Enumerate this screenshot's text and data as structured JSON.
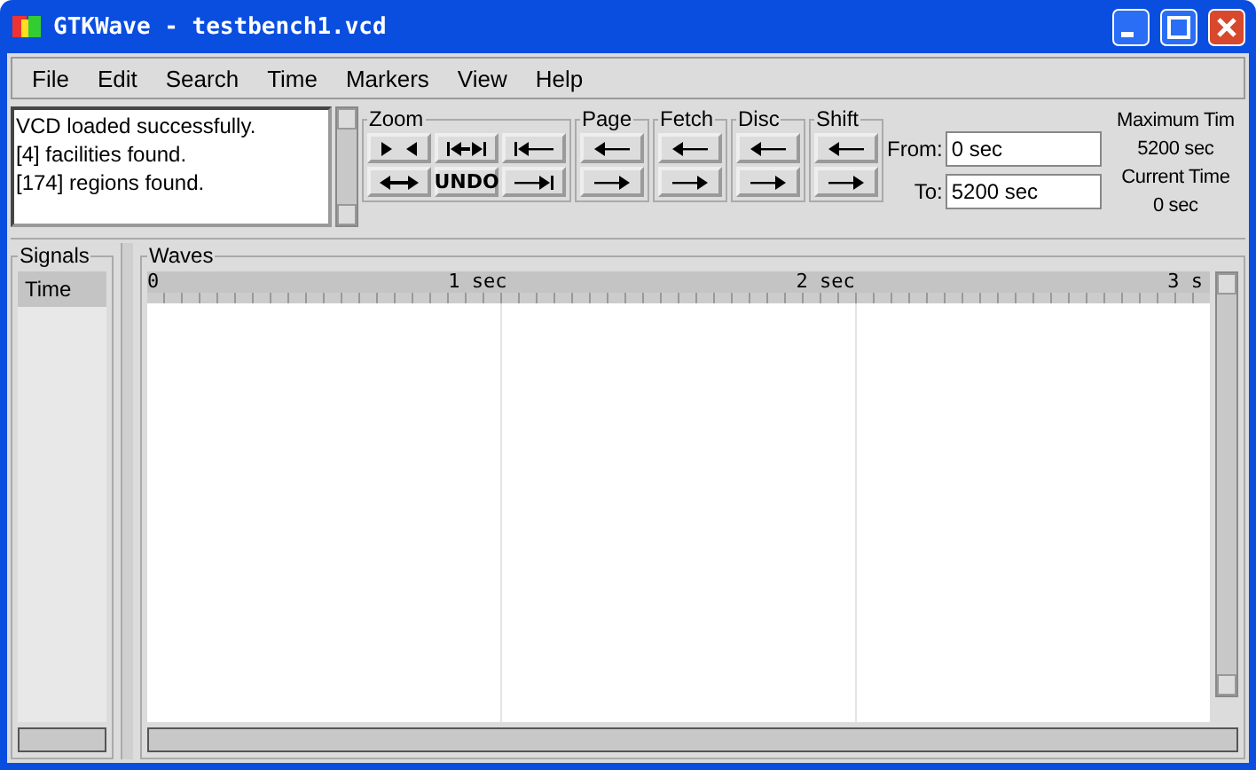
{
  "window": {
    "title": "GTKWave - testbench1.vcd"
  },
  "menu": [
    "File",
    "Edit",
    "Search",
    "Time",
    "Markers",
    "View",
    "Help"
  ],
  "log": [
    "VCD loaded successfully.",
    "[4] facilities found.",
    "[174] regions found."
  ],
  "groups": [
    {
      "title": "Zoom",
      "buttons": [
        {
          "kind": "in"
        },
        {
          "kind": "fit"
        },
        {
          "kind": "start"
        },
        {
          "kind": "out"
        },
        {
          "kind": "text",
          "label": "UNDO"
        },
        {
          "kind": "end"
        }
      ]
    },
    {
      "title": "Page",
      "buttons": [
        {
          "kind": "left"
        },
        {
          "kind": "right"
        }
      ]
    },
    {
      "title": "Fetch",
      "buttons": [
        {
          "kind": "left"
        },
        {
          "kind": "right"
        }
      ]
    },
    {
      "title": "Disc",
      "buttons": [
        {
          "kind": "left"
        },
        {
          "kind": "right"
        }
      ]
    },
    {
      "title": "Shift",
      "buttons": [
        {
          "kind": "left"
        },
        {
          "kind": "right"
        }
      ]
    }
  ],
  "range": {
    "from_label": "From:",
    "from": "0 sec",
    "to_label": "To:",
    "to": "5200 sec"
  },
  "times": [
    "Maximum Tim",
    "5200 sec",
    "Current Time",
    "0 sec"
  ],
  "signals": {
    "title": "Signals",
    "items": [
      "Time"
    ]
  },
  "waves": {
    "title": "Waves",
    "ruler": [
      "0",
      "1 sec",
      "2 sec",
      "3 s"
    ]
  }
}
